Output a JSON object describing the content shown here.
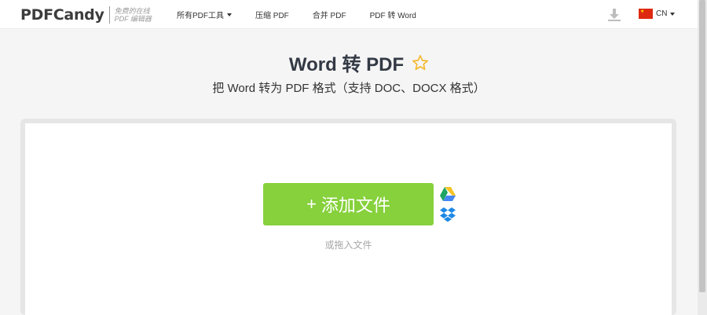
{
  "header": {
    "logo": {
      "main": "PDFCandy",
      "tag_line1": "免费的在线",
      "tag_line2": "PDF 编辑器"
    },
    "nav": [
      {
        "label": "所有PDF工具",
        "has_dropdown": true
      },
      {
        "label": "压缩 PDF"
      },
      {
        "label": "合并 PDF"
      },
      {
        "label": "PDF 转 Word"
      }
    ],
    "download_icon": "download-icon",
    "language": {
      "code": "CN",
      "flag": "china-flag"
    }
  },
  "main": {
    "title": "Word 转 PDF",
    "favorite_icon": "star-outline-icon",
    "subtitle": "把 Word 转为 PDF 格式（支持 DOC、DOCX 格式）"
  },
  "upload": {
    "add_button_label": "添加文件",
    "add_button_plus": "+",
    "drop_hint": "或拖入文件",
    "sources": [
      "google-drive-icon",
      "dropbox-icon"
    ]
  },
  "colors": {
    "accent_green": "#86d13c",
    "star_yellow": "#f5b82e",
    "title_text": "#333a45"
  }
}
